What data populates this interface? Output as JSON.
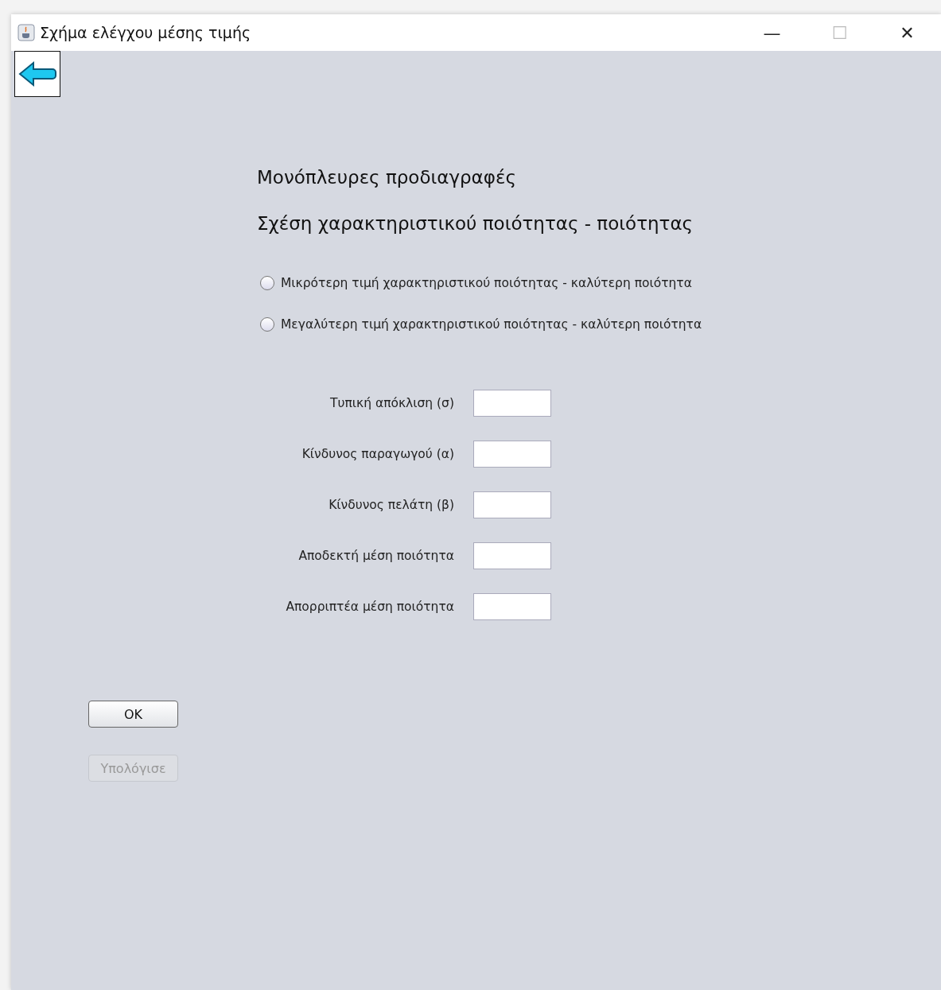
{
  "window": {
    "title": "Σχήμα ελέγχου μέσης τιμής",
    "controls": [
      "—",
      "☐",
      "✕"
    ]
  },
  "headings": [
    "Μονόπλευρες προδιαγραφές",
    "Σχέση χαρακτηριστικού ποιότητας - ποιότητας"
  ],
  "options": [
    {
      "label": "Μικρότερη τιμή χαρακτηριστικού ποιότητας - καλύτερη ποιότητα",
      "selected": false
    },
    {
      "label": "Μεγαλύτερη τιμή χαρακτηριστικού ποιότητας - καλύτερη ποιότητα",
      "selected": false
    }
  ],
  "fields": [
    {
      "label": "Τυπική απόκλιση (σ)"
    },
    {
      "label": "Κίνδυνος παραγωγού (α)"
    },
    {
      "label": "Κίνδυνος πελάτη (β)"
    },
    {
      "label": "Αποδεκτή μέση ποιότητα"
    },
    {
      "label": "Απορριπτέα μέση ποιότητα"
    }
  ],
  "buttons": [
    {
      "label": "OK",
      "disabled": false
    },
    {
      "label": "Υπολόγισε",
      "disabled": true
    }
  ]
}
